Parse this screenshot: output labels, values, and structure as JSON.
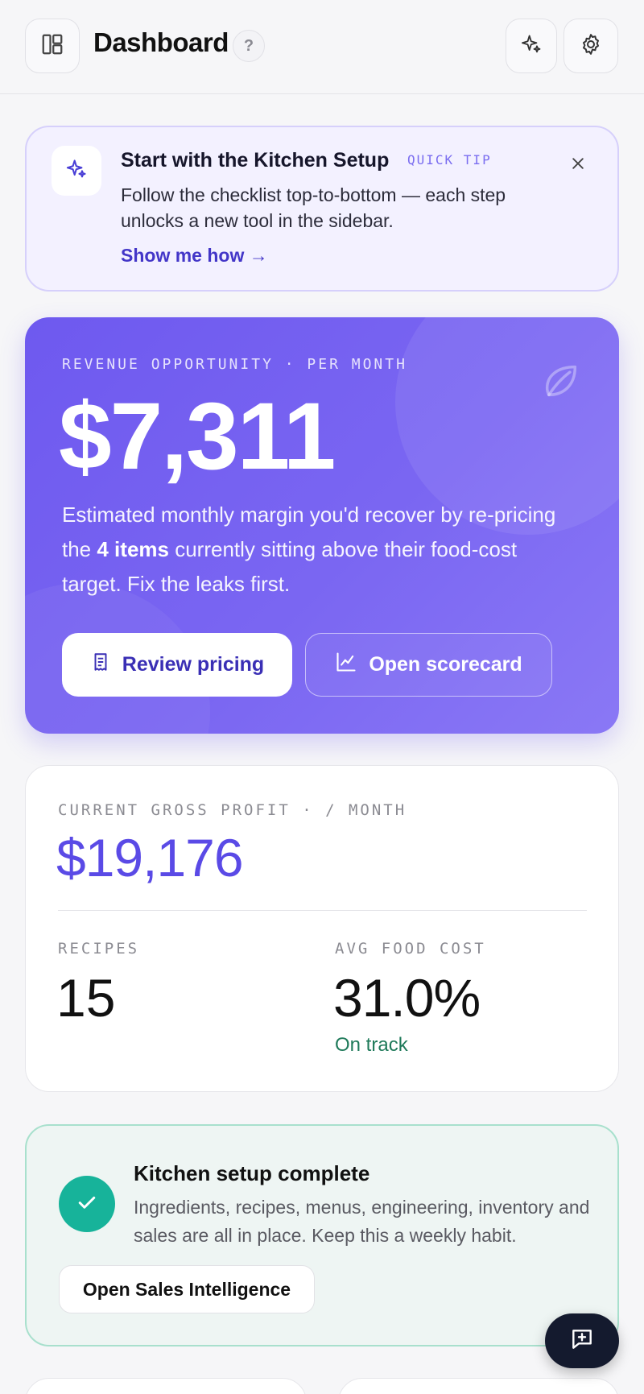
{
  "header": {
    "title": "Dashboard",
    "help_label": "?"
  },
  "tip": {
    "title": "Start with the Kitchen Setup",
    "tag": "QUICK TIP",
    "body": "Follow the checklist top-to-bottom — each step unlocks a new tool in the sidebar.",
    "link": "Show me how →"
  },
  "hero": {
    "label": "REVENUE OPPORTUNITY · PER MONTH",
    "amount": "$7,311",
    "text_before": "Estimated monthly margin you'd recover by re-pricing the ",
    "text_bold": "4 items",
    "text_after": " currently sitting above their food-cost target. Fix the leaks first.",
    "primary_button": "Review pricing",
    "secondary_button": "Open scorecard"
  },
  "stats": {
    "gross_profit_label": "CURRENT GROSS PROFIT · / MONTH",
    "gross_profit_value": "$19,176",
    "recipes_label": "RECIPES",
    "recipes_value": "15",
    "food_cost_label": "AVG FOOD COST",
    "food_cost_value": "31.0%",
    "food_cost_status": "On track"
  },
  "setup": {
    "title": "Kitchen setup complete",
    "body": "Ingredients, recipes, menus, engineering, inventory and sales are all in place. Keep this a weekly habit.",
    "button": "Open Sales Intelligence"
  },
  "colors": {
    "accent": "#6e59ef",
    "success": "#17b39a",
    "status_ok": "#1f7a5a"
  },
  "icons": {
    "sidebar": "sidebar-layout-icon",
    "sparkle": "sparkle-icon",
    "settings": "gear-icon",
    "close": "close-icon",
    "leaf": "leaf-icon",
    "receipt": "receipt-icon",
    "chart": "line-chart-icon",
    "check": "check-icon",
    "chat": "message-plus-icon"
  }
}
